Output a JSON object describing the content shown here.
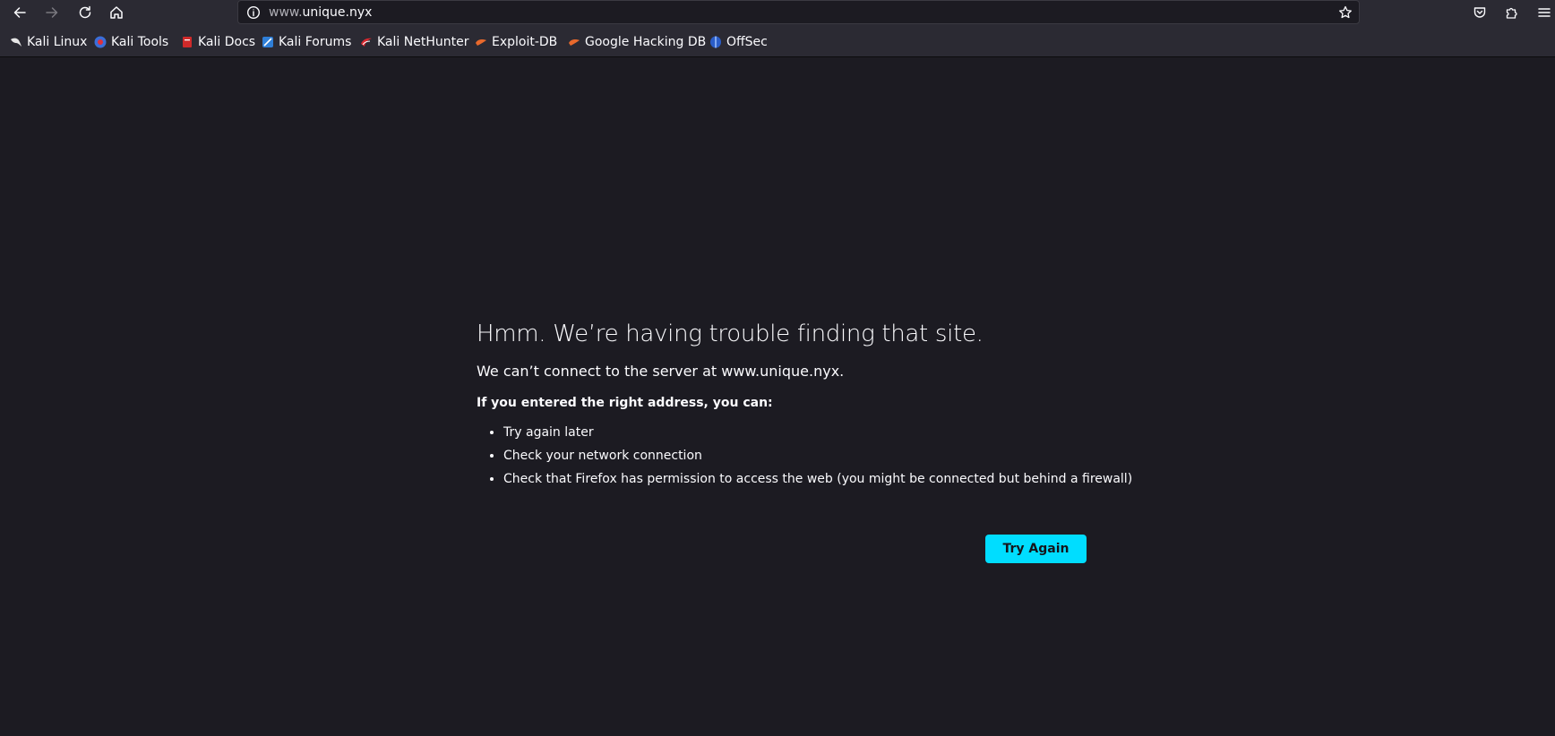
{
  "nav": {
    "url_prefix": "www.",
    "url_domain": "unique.nyx",
    "back_icon": "arrow-left-icon",
    "forward_icon": "arrow-right-icon",
    "reload_icon": "reload-icon",
    "home_icon": "home-icon"
  },
  "bookmarks": [
    {
      "label": "Kali Linux",
      "icon": "kali-linux-icon"
    },
    {
      "label": "Kali Tools",
      "icon": "kali-tools-icon"
    },
    {
      "label": "Kali Docs",
      "icon": "kali-docs-icon"
    },
    {
      "label": "Kali Forums",
      "icon": "kali-forums-icon"
    },
    {
      "label": "Kali NetHunter",
      "icon": "kali-nethunter-icon"
    },
    {
      "label": "Exploit-DB",
      "icon": "exploit-db-icon"
    },
    {
      "label": "Google Hacking DB",
      "icon": "google-hacking-db-icon"
    },
    {
      "label": "OffSec",
      "icon": "offsec-icon"
    }
  ],
  "error": {
    "title": "Hmm. We’re having trouble finding that site.",
    "description": "We can’t connect to the server at www.unique.nyx.",
    "subhead": "If you entered the right address, you can:",
    "items": [
      "Try again later",
      "Check your network connection",
      "Check that Firefox has permission to access the web (you might be connected but behind a firewall)"
    ],
    "button": "Try Again"
  },
  "colors": {
    "background": "#1c1b22",
    "toolbar": "#2b2a33",
    "accent": "#00ddff"
  }
}
